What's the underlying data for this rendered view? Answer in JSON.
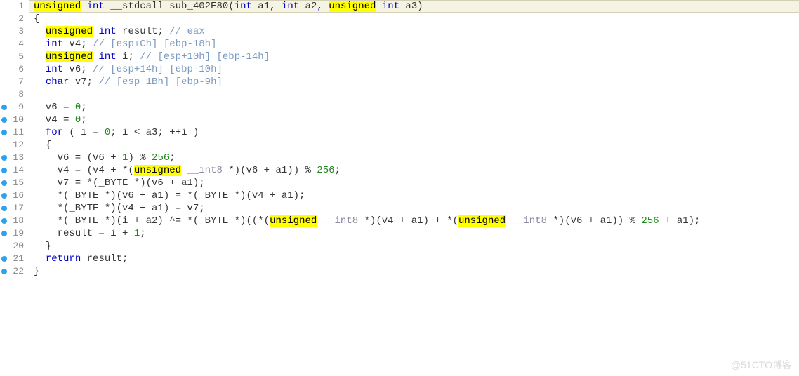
{
  "watermark": "@51CTO博客",
  "lines": [
    {
      "n": 1,
      "bp": false,
      "current": true,
      "tokens": [
        [
          "hl",
          "unsigned"
        ],
        [
          "txt",
          " "
        ],
        [
          "ty",
          "int"
        ],
        [
          "txt",
          " __stdcall sub_402E80("
        ],
        [
          "ty",
          "int"
        ],
        [
          "txt",
          " a1"
        ],
        [
          "kw",
          ","
        ],
        [
          "txt",
          " "
        ],
        [
          "ty",
          "int"
        ],
        [
          "txt",
          " a2"
        ],
        [
          "kw",
          ","
        ],
        [
          "txt",
          " "
        ],
        [
          "hl",
          "unsigned"
        ],
        [
          "txt",
          " "
        ],
        [
          "ty",
          "int"
        ],
        [
          "txt",
          " a3)"
        ]
      ]
    },
    {
      "n": 2,
      "bp": false,
      "tokens": [
        [
          "br",
          "{"
        ]
      ]
    },
    {
      "n": 3,
      "bp": false,
      "tokens": [
        [
          "txt",
          "  "
        ],
        [
          "hl",
          "unsigned"
        ],
        [
          "txt",
          " "
        ],
        [
          "ty",
          "int"
        ],
        [
          "txt",
          " result; "
        ],
        [
          "cmt",
          "// eax"
        ]
      ]
    },
    {
      "n": 4,
      "bp": false,
      "tokens": [
        [
          "txt",
          "  "
        ],
        [
          "ty",
          "int"
        ],
        [
          "txt",
          " v4; "
        ],
        [
          "cmt",
          "// [esp+Ch] [ebp-18h]"
        ]
      ]
    },
    {
      "n": 5,
      "bp": false,
      "tokens": [
        [
          "txt",
          "  "
        ],
        [
          "hl",
          "unsigned"
        ],
        [
          "txt",
          " "
        ],
        [
          "ty",
          "int"
        ],
        [
          "txt",
          " i; "
        ],
        [
          "cmt",
          "// [esp+10h] [ebp-14h]"
        ]
      ]
    },
    {
      "n": 6,
      "bp": false,
      "tokens": [
        [
          "txt",
          "  "
        ],
        [
          "ty",
          "int"
        ],
        [
          "txt",
          " v6; "
        ],
        [
          "cmt",
          "// [esp+14h] [ebp-10h]"
        ]
      ]
    },
    {
      "n": 7,
      "bp": false,
      "tokens": [
        [
          "txt",
          "  "
        ],
        [
          "ty",
          "char"
        ],
        [
          "txt",
          " v7; "
        ],
        [
          "cmt",
          "// [esp+1Bh] [ebp-9h]"
        ]
      ]
    },
    {
      "n": 8,
      "bp": false,
      "tokens": [
        [
          "txt",
          ""
        ]
      ]
    },
    {
      "n": 9,
      "bp": true,
      "tokens": [
        [
          "txt",
          "  v6 = "
        ],
        [
          "num",
          "0"
        ],
        [
          "txt",
          ";"
        ]
      ]
    },
    {
      "n": 10,
      "bp": true,
      "tokens": [
        [
          "txt",
          "  v4 = "
        ],
        [
          "num",
          "0"
        ],
        [
          "txt",
          ";"
        ]
      ]
    },
    {
      "n": 11,
      "bp": true,
      "tokens": [
        [
          "txt",
          "  "
        ],
        [
          "kw",
          "for"
        ],
        [
          "txt",
          " ( i = "
        ],
        [
          "num",
          "0"
        ],
        [
          "txt",
          "; i < a3; ++i )"
        ]
      ]
    },
    {
      "n": 12,
      "bp": false,
      "tokens": [
        [
          "txt",
          "  "
        ],
        [
          "br",
          "{"
        ]
      ]
    },
    {
      "n": 13,
      "bp": true,
      "tokens": [
        [
          "txt",
          "    v6 = (v6 + "
        ],
        [
          "num",
          "1"
        ],
        [
          "txt",
          ") % "
        ],
        [
          "num",
          "256"
        ],
        [
          "txt",
          ";"
        ]
      ]
    },
    {
      "n": 14,
      "bp": true,
      "tokens": [
        [
          "txt",
          "    v4 = (v4 + *("
        ],
        [
          "hl",
          "unsigned"
        ],
        [
          "txt",
          " "
        ],
        [
          "dimkw",
          "__int8"
        ],
        [
          "txt",
          " *)(v6 + a1)) % "
        ],
        [
          "num",
          "256"
        ],
        [
          "txt",
          ";"
        ]
      ]
    },
    {
      "n": 15,
      "bp": true,
      "tokens": [
        [
          "txt",
          "    v7 = *(_BYTE *)(v6 + a1);"
        ]
      ]
    },
    {
      "n": 16,
      "bp": true,
      "tokens": [
        [
          "txt",
          "    *(_BYTE *)(v6 + a1) = *(_BYTE *)(v4 + a1);"
        ]
      ]
    },
    {
      "n": 17,
      "bp": true,
      "tokens": [
        [
          "txt",
          "    *(_BYTE *)(v4 + a1) = v7;"
        ]
      ]
    },
    {
      "n": 18,
      "bp": true,
      "tokens": [
        [
          "txt",
          "    *(_BYTE *)(i + a2) ^= *(_BYTE *)((*("
        ],
        [
          "hl",
          "unsigned"
        ],
        [
          "txt",
          " "
        ],
        [
          "dimkw",
          "__int8"
        ],
        [
          "txt",
          " *)(v4 + a1) + *("
        ],
        [
          "hl",
          "unsigned"
        ],
        [
          "txt",
          " "
        ],
        [
          "dimkw",
          "__int8"
        ],
        [
          "txt",
          " *)(v6 + a1)) % "
        ],
        [
          "num",
          "256"
        ],
        [
          "txt",
          " + a1);"
        ]
      ]
    },
    {
      "n": 19,
      "bp": true,
      "tokens": [
        [
          "txt",
          "    result = i + "
        ],
        [
          "num",
          "1"
        ],
        [
          "txt",
          ";"
        ]
      ]
    },
    {
      "n": 20,
      "bp": false,
      "tokens": [
        [
          "txt",
          "  "
        ],
        [
          "br",
          "}"
        ]
      ]
    },
    {
      "n": 21,
      "bp": true,
      "tokens": [
        [
          "txt",
          "  "
        ],
        [
          "kw",
          "return"
        ],
        [
          "txt",
          " result;"
        ]
      ]
    },
    {
      "n": 22,
      "bp": true,
      "tokens": [
        [
          "br",
          "}"
        ]
      ]
    }
  ]
}
